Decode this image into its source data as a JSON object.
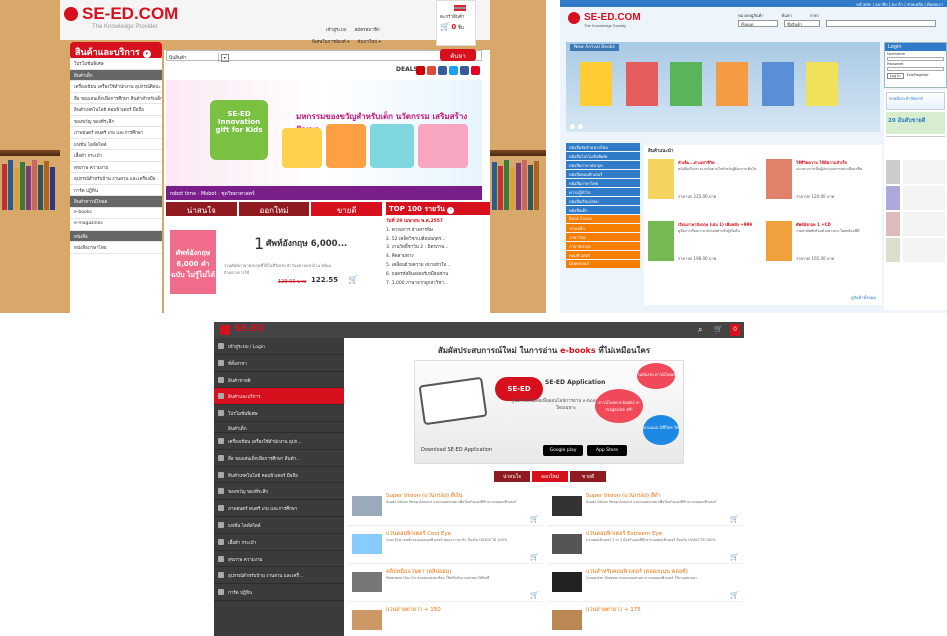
{
  "panel1": {
    "logo": "SE-ED.COM",
    "tagline": "The Knowledge Provider",
    "header_links": [
      "เข้าสู่ระบบ",
      "สมัครสมาชิก",
      "พิเศษในการผ้องค์ ▾",
      "ค้นหาใหม่ ▾"
    ],
    "cart_label": "ตะกร้าสินค้า",
    "cart_count": "0",
    "cart_unit": "ชิ้น",
    "category_button": "สินค้าและบริการ",
    "search_category": "นินสินค้า",
    "search_button": "ค้นหา",
    "deals_label": "DEALS",
    "sidebar": [
      {
        "label": "โปรโมชั่นพิเศษ",
        "head": false
      },
      {
        "label": "สินค้าเด็ก",
        "head": true
      },
      {
        "label": "เครื่องเขียน เครื่องใช้สำนักงาน อุปกรณ์ศิลปะ",
        "head": false
      },
      {
        "label": "สื่อ ของเล่นเด็กเพื่อการศึกษา สินค้าสำหรับเด็ก",
        "head": false
      },
      {
        "label": "สินค้าเทคโนโลยี คอมพิวเตอร์ มือถือ",
        "head": false
      },
      {
        "label": "ของขวัญ ของที่ระลึก",
        "head": false
      },
      {
        "label": "ภาพยนตร์ ดนตรี เกม และการศึกษา",
        "head": false
      },
      {
        "label": "แฟชั่น ไลฟ์สไตล์",
        "head": false
      },
      {
        "label": "เสื้อผ้า กระเป๋า",
        "head": false
      },
      {
        "label": "สุขภาพ ความงาม",
        "head": false
      },
      {
        "label": "อุปกรณ์สำหรับบ้าน งานสวน และเครื่องมือ",
        "head": false
      },
      {
        "label": "การ์ด ปฏิทิน",
        "head": false
      },
      {
        "label": "สินค้าดาวน์โหลด",
        "head": true
      },
      {
        "label": "e-books",
        "head": false
      },
      {
        "label": "e-magazines",
        "head": false
      },
      {
        "label": "หนังสือ",
        "head": true
      },
      {
        "label": "หนังสือภาษาไทย",
        "head": false
      }
    ],
    "banner_title": "มหกรรมของขวัญสำหรับเด็ก นวัตกรรม เสริมสร้างปัญญา",
    "banner_logo": "SE-ED Innovation gift for Kids",
    "banner_bar": "robot time · Mobot · ชุดวิทยาศาสตร์",
    "tabs": [
      "น่าสนใจ",
      "ออกใหม่",
      "ขายดี"
    ],
    "active_tab": 2,
    "top100_title": "TOP 100 รายวัน",
    "top100_date": "วันที่ 29 เมษายน พ.ศ.2557",
    "top100": [
      "1. คาถอการ ล้างสารพิษ",
      "2. 52 เคล็ดวิชาเปลี่ยนพฤตร...",
      "3. งานวิทยิ์ชาวิน 2 : มิตรภาพ...",
      "4. คิดสามทาง",
      "5. เคลื่อนย้ายความ สบายหัวใจ...",
      "6. ถอดรหัสอินสเตอร์เหมือนซ่าน",
      "7. 1,000 ภาษาจากลูกสาวิชา..."
    ],
    "feature": {
      "rank": "1",
      "title": "ศัพท์อังกฤษ 6,000...",
      "cover_text": "ศัพท์อังกฤษ 6,000 คำ ฉบับ ไม่รู้ไม่ได้",
      "desc": "รวมศัพท์ภาษาอังกฤษที่ใช้ในชีวิตประจำวันอย่างครบถ้วน พร้อมตัวอย่างการใช้",
      "old_price": "129.00 บาท",
      "new_price": "122.55"
    }
  },
  "panel2": {
    "logo": "SE-ED.COM",
    "tagline": "The Knowledge Society",
    "top_links": "หน้าหลัก | สมาชิก | ตะกร้า | ช่วยเหลือ | ติดต่อเรา",
    "search_labels": [
      "หมวดหมู่สินค้า",
      "ค้นหา",
      "ราคา"
    ],
    "search_category": "ทั้งหมด",
    "search_sub": "ชื่อสินค้า",
    "banner_title": "New Arrival Books",
    "login_title": "Login",
    "login_fields": [
      "Username",
      "Password"
    ],
    "login_buttons": [
      "Log In",
      "Exit/Register"
    ],
    "side_items": [
      "หนังสือจัดจำหน่ายใหม่",
      "หนังสือโปรโมชั่นพิเศษ",
      "หนังสือภาษาอังกฤษ",
      "หนังสือคอมพิวเตอร์",
      "หนังสือภาษาไทย",
      "ความรู้ทั่วไป",
      "หนังสือเรียน/สอบ",
      "หนังสือเด็ก",
      "Book Focus",
      "ช่างเหล็ก",
      "ภาษาไทย",
      "ภาษาอังกฤษ",
      "คอมพิวเตอร์",
      "Download"
    ],
    "section_title": "สินค้าแนะนำ",
    "items": [
      {
        "title": "ตัวเต็ม...ต่างเท่าชีวิต",
        "desc": "หนังสือเรื่องราวแรงบันดาลใจสำหรับผู้ต้องการเติบโต",
        "price": "ราคาปก 225.00 บาท"
      },
      {
        "title": "ใช้ชีวิตความ ให้มีความสำเร็จ",
        "desc": "แนวทางการเป็นผู้ประกอบการอย่างมืออาชีพ",
        "price": "ราคาปก 120.00 บาท"
      },
      {
        "title": "เรียนภาษาอังกฤษ (เล่ม 1) เพิ่มพลัง +999",
        "desc": "คู่มือการเรียนภาษาอังกฤษสำหรับผู้เริ่มต้น",
        "price": "ราคาปก 198.00 บาท"
      },
      {
        "title": "ศัพท์อังกฤษ 1 +CD",
        "desc": "รวมคำศัพท์พร้อมตัวอย่างประโยคพร้อมซีดี",
        "price": "ราคาปก 165.00 บาท"
      }
    ],
    "more_link": "ดูสินค้าทั้งหมด",
    "best_title": "ขายดีประจำสัปดาห์",
    "best_badge": "20 อันดับขายดี"
  },
  "panel3": {
    "logo_prefix": "SE-",
    "logo_suffix": "ED",
    "cart_count": "0",
    "side_items": [
      {
        "label": "เข้าสู่ระบบ / Login",
        "type": "item"
      },
      {
        "label": "ที่ตั้งสาขา",
        "type": "item"
      },
      {
        "label": "สินค้าขายดี",
        "type": "item"
      },
      {
        "label": "สินค้าและบริการ",
        "type": "red"
      },
      {
        "label": "โปรโมชั่นพิเศษ",
        "type": "item"
      },
      {
        "label": "สินค้าเด็ก",
        "type": "head"
      },
      {
        "label": "เครื่องเขียน เครื่องใช้สำนักงาน อุปก...",
        "type": "item"
      },
      {
        "label": "สื่อ ของเล่นเด็กเพื่อการศึกษา สินค้า...",
        "type": "item"
      },
      {
        "label": "สินค้าเทคโนโลยี คอมพิวเตอร์ มือถือ",
        "type": "item"
      },
      {
        "label": "ของขวัญ ของที่ระลึก",
        "type": "item"
      },
      {
        "label": "ภาพยนตร์ ดนตรี เกม และการศึกษา",
        "type": "item"
      },
      {
        "label": "แฟชั่น ไลฟ์สไตล์",
        "type": "item"
      },
      {
        "label": "เสื้อผ้า กระเป๋า",
        "type": "item"
      },
      {
        "label": "สุขภาพ ความงาม",
        "type": "item"
      },
      {
        "label": "อุปกรณ์สำหรับบ้าน งานสวน และเครื่...",
        "type": "item"
      },
      {
        "label": "การ์ด ปฏิทิน",
        "type": "item"
      }
    ],
    "headline_prefix": "สัมผัสประสบการณ์ใหม่ ในการอ่าน ",
    "headline_brand": "e-books",
    "headline_suffix": " ที่ไม่เหมือนใคร",
    "app_title": "SE-ED Application",
    "app_desc": "ศูนย์รวมหนังสือเพื่อออนไลน์การอ่าน e-books ภาษาไทย โดยเฉพาะ",
    "bubbles": [
      "ไม่ต้องรอ ดาวน์โหลด",
      "ดาวน์โหลด e-books e-magazine ฟรี!",
      "อ่านแบบ Offline ได้"
    ],
    "download_label": "Download SE-ED Application",
    "store_badges": [
      "Google play",
      "App Store"
    ],
    "tabs": [
      "น่าสนใจ",
      "ออกใหม่",
      "ขายดี"
    ],
    "active_tab": 1,
    "products": [
      {
        "title": "Super Vision (แว่นกรอง) สีเงิน",
        "desc": "Super Vision Wrap Around แว่นถนอมสายตาเพื่อป้องกันแสงสีฟ้าจากจอคอมพิวเตอร์"
      },
      {
        "title": "Super Vision (แว่นกรอง) สีดำ",
        "desc": "Super Vision Wrap Around แว่นถนอมสายตาเพื่อป้องกันแสงสีฟ้าจากจอคอมพิวเตอร์"
      },
      {
        "title": "แว่นคอมพิวเตอร์ Cool Eye",
        "desc": "Cool Eye เลนส์กรองแสงคอมพิวเตอร์ ลดอาการตาล้า ป้องกัน UV400 ได้ 100%"
      },
      {
        "title": "แว่นคอมพิวเตอร์ Extreem Eye",
        "desc": "แว่นคอมพิวเตอร์ 2 in 1 ป้องกันแสงสีฟ้าจากจอคอมพิวเตอร์ ป้องกัน UV400 ได้ 100%"
      },
      {
        "title": "คลิปหนีบแว่นตา (คลิปออน)",
        "desc": "Polarised Clip-On ช่วยลดแสงสะท้อน ใช้หนีบกับแว่นสายตาได้ทันที"
      },
      {
        "title": "แว่นสำหรับคอมพิวเตอร์ (คลองแนน คลอซ์)",
        "desc": "Computer Glasses ช่วยถนอมสายตาจากจอคอมพิวเตอร์ ใช้งานสบายตา"
      },
      {
        "title": "แว่นสายตายาว + 150",
        "desc": ""
      },
      {
        "title": "แว่นสายตายาว + 175",
        "desc": ""
      }
    ]
  }
}
